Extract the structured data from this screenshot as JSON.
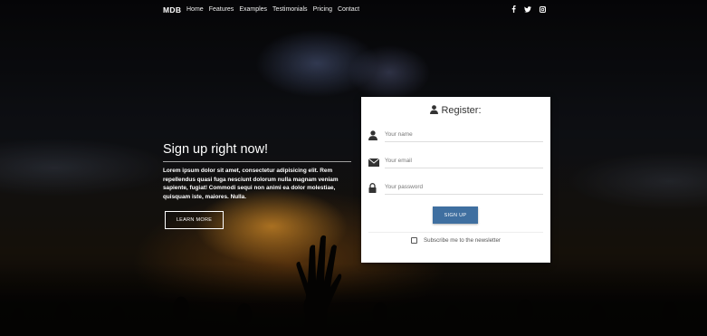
{
  "navbar": {
    "brand": "MDB",
    "links": [
      "Home",
      "Features",
      "Examples",
      "Testimonials",
      "Pricing",
      "Contact"
    ],
    "social_icons": [
      "facebook-icon",
      "twitter-icon",
      "instagram-icon"
    ]
  },
  "hero": {
    "title": "Sign up right now!",
    "text": "Lorem ipsum dolor sit amet, consectetur adipisicing elit. Rem repellendus quasi fuga nesciunt dolorum nulla magnam veniam sapiente, fugiat! Commodi sequi non animi ea dolor molestiae, quisquam iste, maiores. Nulla.",
    "button_label": "LEARN MORE"
  },
  "register": {
    "title": "Register:",
    "title_icon": "user-icon",
    "fields": [
      {
        "icon": "user-icon",
        "placeholder": "Your name",
        "value": ""
      },
      {
        "icon": "envelope-icon",
        "placeholder": "Your email",
        "value": ""
      },
      {
        "icon": "lock-icon",
        "placeholder": "Your password",
        "value": ""
      }
    ],
    "button_label": "SIGN UP",
    "newsletter_label": "Subscribe me to the newsletter",
    "newsletter_checked": false
  },
  "colors": {
    "accent": "#3f6fa0",
    "card_bg": "#ffffff"
  }
}
